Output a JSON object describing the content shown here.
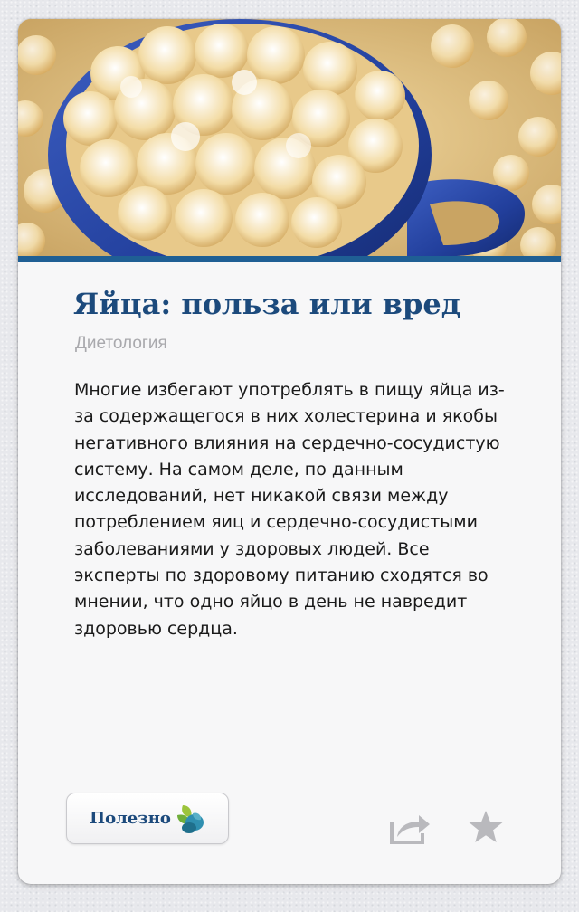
{
  "article": {
    "image_icon": "popcorn-photo",
    "title": "Яйца: польза или вред",
    "category": "Диетология",
    "body": "Многие избегают употреблять в пищу яйца из-за содержащегося в них холестерина и якобы негативного влияния на сердечно-сосудистую систему. На самом деле, по данным исследований, нет никакой связи между потреблением яиц и сердечно-сосудистыми заболеваниями у здоровых людей. Все эксперты по здоровому питанию сходятся во мнении, что одно яйцо в день не навредит здоровью сердца."
  },
  "actions": {
    "useful_label": "Полезно",
    "useful_icon": "leaves-icon",
    "share_icon": "share-icon",
    "favorite_icon": "star-icon"
  },
  "colors": {
    "accent": "#1f5f94",
    "title": "#1c4a7c",
    "category": "#a9a9ad",
    "text": "#1a1a1a"
  }
}
